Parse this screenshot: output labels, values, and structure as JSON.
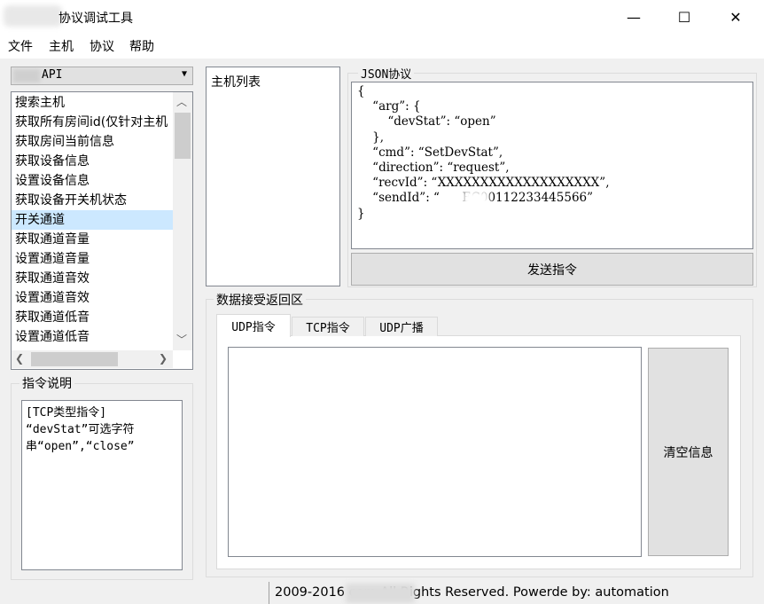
{
  "window": {
    "title": "协议调试工具",
    "minimize": "—",
    "maximize": "☐",
    "close": "✕"
  },
  "menu": [
    "文件",
    "主机",
    "协议",
    "帮助"
  ],
  "api_combo": {
    "selected": "API"
  },
  "command_list": {
    "items": [
      "搜索主机",
      "获取所有房间id(仅针对主机",
      "获取房间当前信息",
      "获取设备信息",
      "设置设备信息",
      "获取设备开关机状态",
      "开关通道",
      "获取通道音量",
      "设置通道音量",
      "获取通道音效",
      "设置通道音效",
      "获取通道低音",
      "设置通道低音"
    ],
    "selected_index": 6
  },
  "instruction": {
    "label": "指令说明",
    "text_lines": [
      "[TCP类型指令]",
      "“devStat”可选字符",
      "串“open”,“close”"
    ]
  },
  "host_list": {
    "label": "主机列表"
  },
  "json_protocol": {
    "label": "JSON协议",
    "lines": [
      "{",
      "    “arg”: {",
      "        “devStat”: “open”",
      "    },",
      "    “cmd”: “SetDevStat”,",
      "    “direction”: “request”,",
      "    “recvId”: “XXXXXXXXXXXXXXXXXXX”,",
      "    “sendId”: “      EC00112233445566”",
      "}"
    ]
  },
  "send_button": "发送指令",
  "receive_area": {
    "label": "数据接受返回区",
    "tabs": [
      "UDP指令",
      "TCP指令",
      "UDP广播"
    ],
    "active_tab": 0,
    "clear_button": "清空信息"
  },
  "status": {
    "text": "2009-2016         com All Rights Reserved. Powerde by:  automation"
  },
  "icons": {
    "combo_arrow": "chevron-down-icon",
    "scroll_up": "scroll-up-icon",
    "scroll_down": "scroll-down-icon",
    "scroll_left": "scroll-left-icon",
    "scroll_right": "scroll-right-icon"
  }
}
